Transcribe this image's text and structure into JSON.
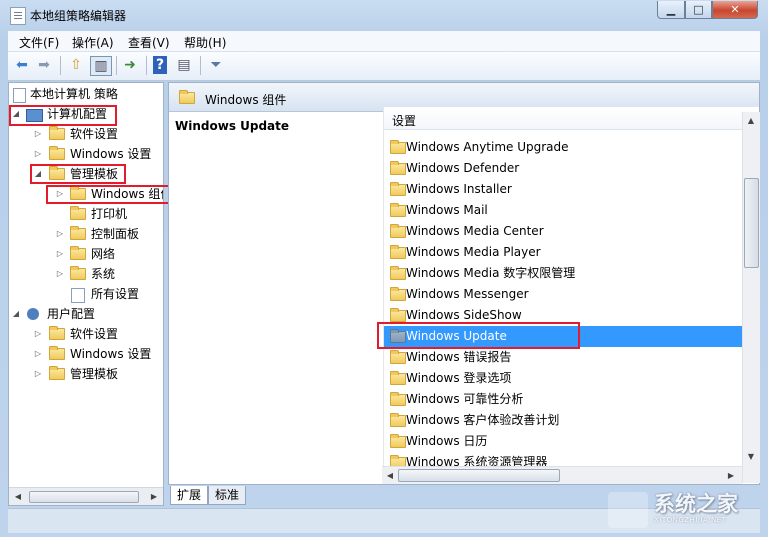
{
  "window": {
    "title": "本地组策略编辑器"
  },
  "menu": [
    "文件(F)",
    "操作(A)",
    "查看(V)",
    "帮助(H)"
  ],
  "tree": {
    "root": "本地计算机 策略",
    "computer_config": "计算机配置",
    "cc_software": "软件设置",
    "cc_windows": "Windows 设置",
    "cc_admin": "管理模板",
    "windows_components": "Windows 组件",
    "printers": "打印机",
    "control_panel": "控制面板",
    "network": "网络",
    "system": "系统",
    "all_settings": "所有设置",
    "user_config": "用户配置",
    "uc_software": "软件设置",
    "uc_windows": "Windows 设置",
    "uc_admin": "管理模板"
  },
  "content": {
    "header": "Windows 组件",
    "detail_title": "Windows Update",
    "column": "设置",
    "items": [
      "Windows Anytime Upgrade",
      "Windows Defender",
      "Windows Installer",
      "Windows Mail",
      "Windows Media Center",
      "Windows Media Player",
      "Windows Media 数字权限管理",
      "Windows Messenger",
      "Windows SideShow",
      "Windows Update",
      "Windows 错误报告",
      "Windows 登录选项",
      "Windows 可靠性分析",
      "Windows 客户体验改善计划",
      "Windows 日历",
      "Windows 系统资源管理器"
    ],
    "selected_index": 9
  },
  "tabs": {
    "extended": "扩展",
    "standard": "标准"
  },
  "watermark": {
    "text": "系统之家",
    "url": "XITONGZHIJIA.NET"
  },
  "colors": {
    "selection": "#3399ff",
    "highlight": "#e21c2c"
  }
}
